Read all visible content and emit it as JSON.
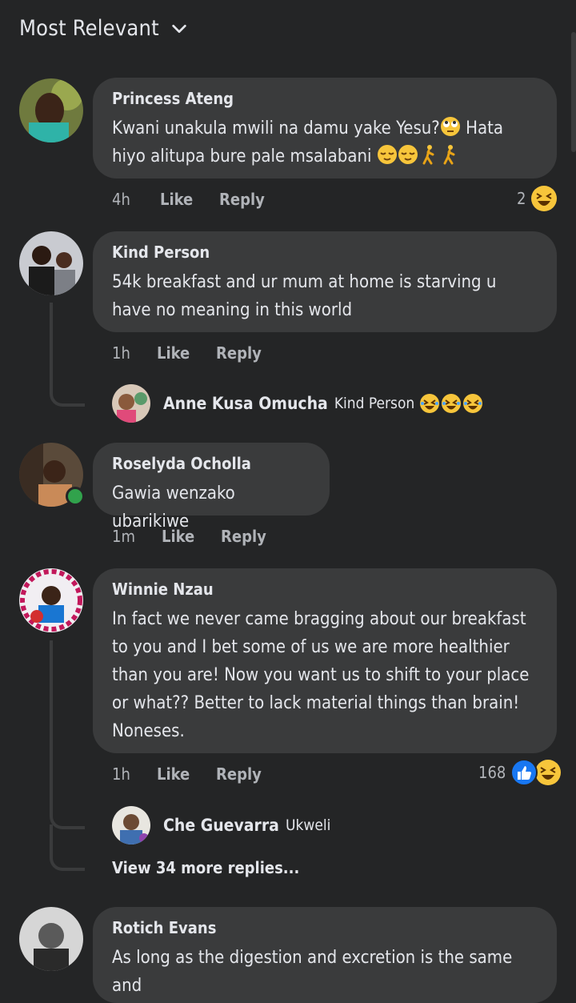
{
  "sort": {
    "label": "Most Relevant"
  },
  "comments": [
    {
      "author": "Princess Ateng",
      "text_parts": [
        "Kwani unakula mwili na damu yake Yesu?",
        " Hata hiyo alitupa bure pale msalabani "
      ],
      "time": "4h",
      "like": "Like",
      "reply": "Reply",
      "reaction_count": "2"
    },
    {
      "author": "Kind Person",
      "text": "54k breakfast and ur mum at home is starving u have no meaning in this world",
      "time": "1h",
      "like": "Like",
      "reply": "Reply",
      "replies": [
        {
          "author": "Anne Kusa Omucha",
          "text": "Kind Person"
        }
      ]
    },
    {
      "author": "Roselyda Ocholla",
      "text": "Gawia wenzako ubarikiwe",
      "time": "1m",
      "like": "Like",
      "reply": "Reply"
    },
    {
      "author": "Winnie Nzau",
      "text": "In fact we never came bragging about our breakfast to you and I bet some of us we are more healthier than you are! Now you want us to shift to your place or what?? Better to lack material things than brain! Noneses.",
      "time": "1h",
      "like": "Like",
      "reply": "Reply",
      "reaction_count": "168",
      "replies": [
        {
          "author": "Che Guevarra",
          "text": "Ukweli"
        }
      ],
      "more_replies": "View 34 more replies..."
    },
    {
      "author": "Rotich Evans",
      "text": "As long as the digestion and excretion is the same and"
    }
  ],
  "colors": {
    "background": "#242526",
    "bubble": "#3a3b3c",
    "like_blue": "#1877f2",
    "online": "#31a24c"
  }
}
